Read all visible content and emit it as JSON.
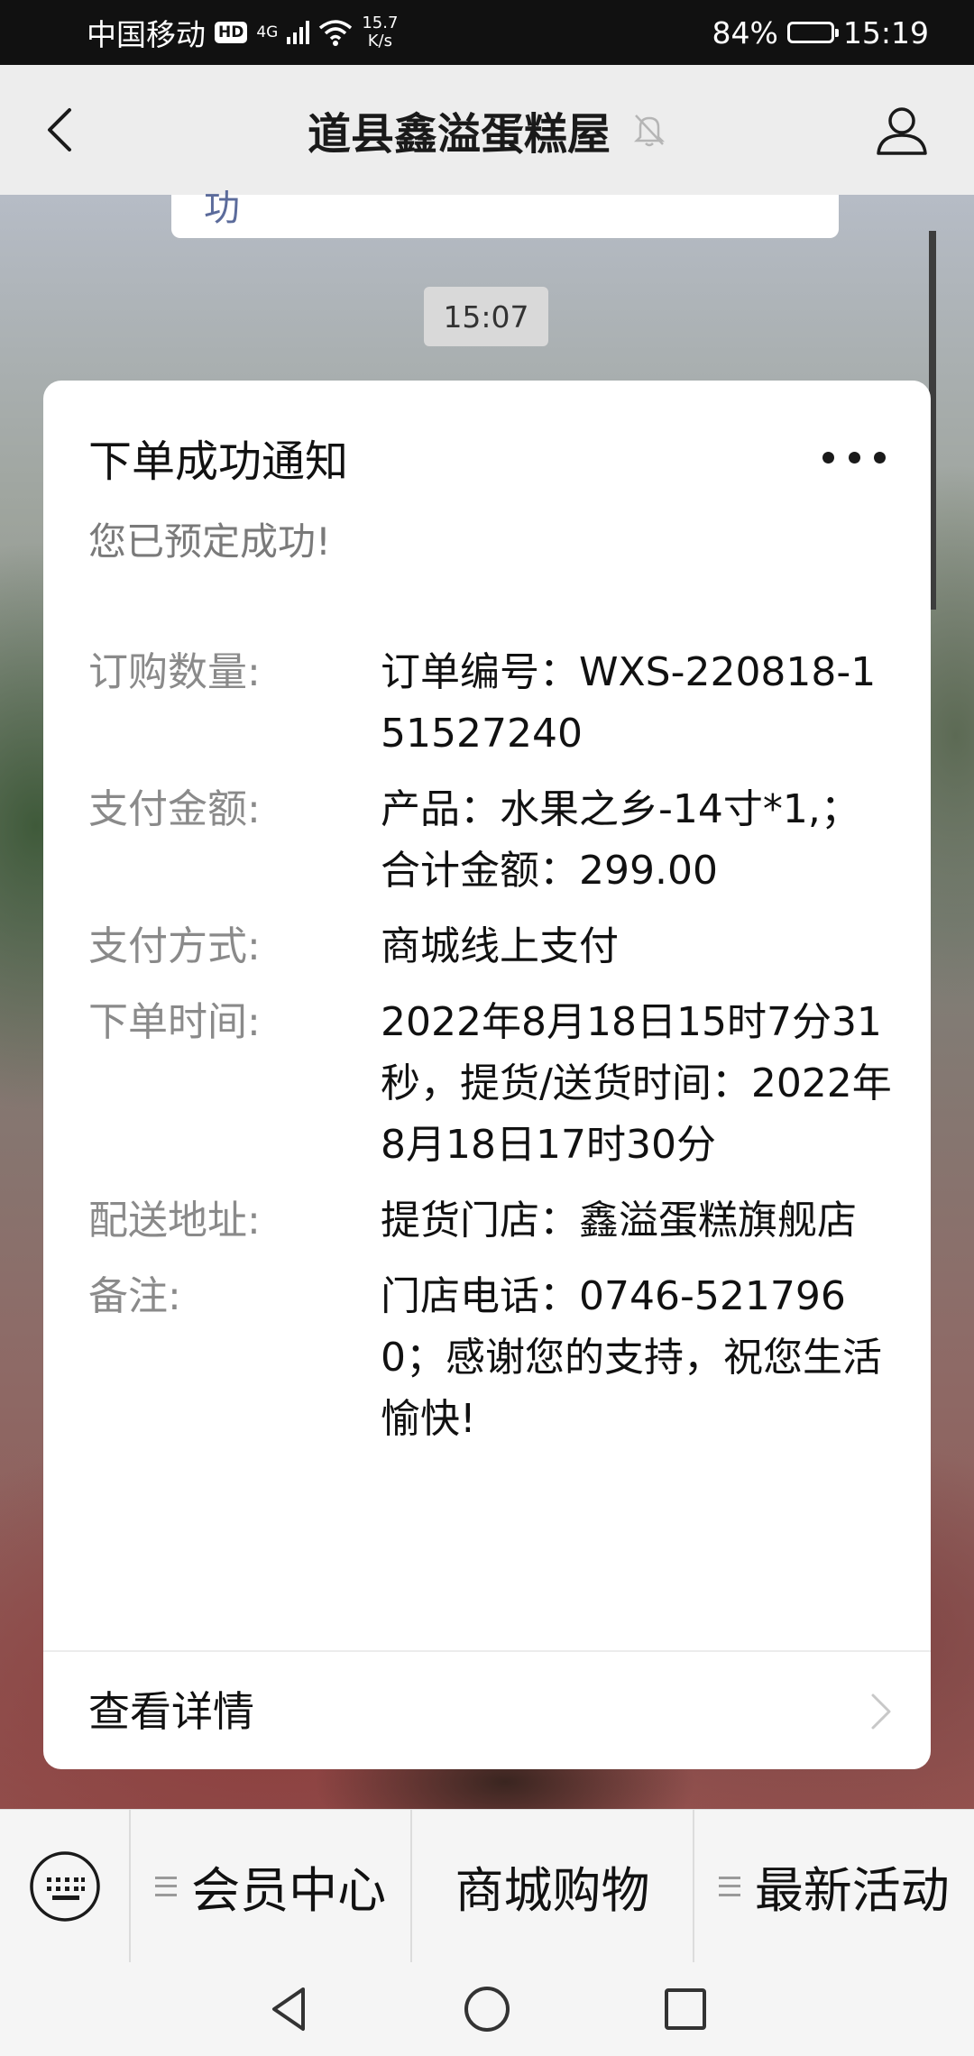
{
  "status_bar": {
    "carrier": "中国移动",
    "hd_badge": "HD",
    "network": "4G",
    "speed_value": "15.7",
    "speed_unit": "K/s",
    "battery_percent": "84%",
    "battery_level": 0.84,
    "time": "15:19"
  },
  "header": {
    "title": "道县鑫溢蛋糕屋",
    "back_icon": "chevron-left-icon",
    "mute_icon": "bell-muted-icon",
    "profile_icon": "person-icon"
  },
  "chat": {
    "previous_message_fragment": "功",
    "timestamp": "15:07"
  },
  "card": {
    "title": "下单成功通知",
    "subtitle": "您已预定成功!",
    "fields": [
      {
        "label": "订购数量:",
        "value": "订单编号：WXS-220818-151527240"
      },
      {
        "label": "支付金额:",
        "value": "产品：水果之乡-14寸*1,；合计金额：299.00"
      },
      {
        "label": "支付方式:",
        "value": "商城线上支付"
      },
      {
        "label": "下单时间:",
        "value": "2022年8月18日15时7分31秒，提货/送货时间：2022年8月18日17时30分"
      },
      {
        "label": "配送地址:",
        "value": "提货门店：鑫溢蛋糕旗舰店"
      },
      {
        "label": "备注:",
        "value": "门店电话：0746-5217960；感谢您的支持，祝您生活愉快!"
      }
    ],
    "detail_link": "查看详情"
  },
  "menu": {
    "items": [
      {
        "label": "会员中心",
        "has_submenu": true
      },
      {
        "label": "商城购物",
        "has_submenu": false
      },
      {
        "label": "最新活动",
        "has_submenu": true
      }
    ]
  },
  "colors": {
    "status_bar_bg": "#111111",
    "nav_bg": "#ededed",
    "card_bg": "#ffffff",
    "label_gray": "#8a8a8a"
  }
}
